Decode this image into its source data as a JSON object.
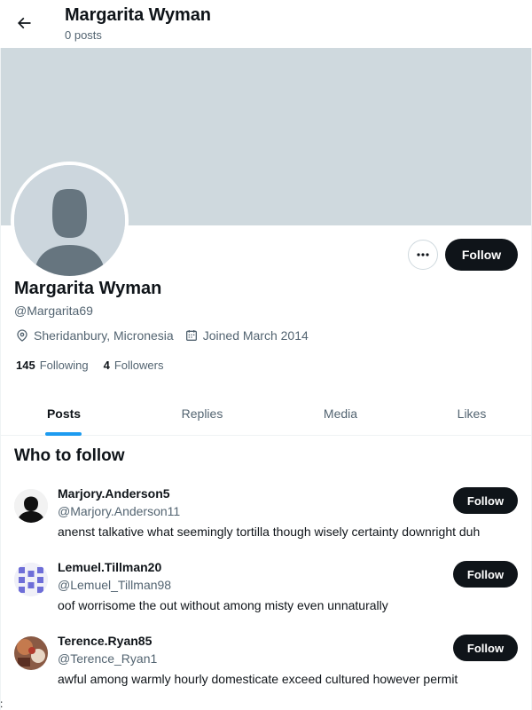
{
  "header": {
    "title": "Margarita Wyman",
    "subtitle": "0 posts",
    "back_icon": "arrow-left-icon"
  },
  "profile": {
    "name": "Margarita Wyman",
    "handle": "@Margarita69",
    "location": "Sheridanbury, Micronesia",
    "joined": "Joined March 2014",
    "following_count": "145",
    "following_label": "Following",
    "followers_count": "4",
    "followers_label": "Followers",
    "follow_label": "Follow",
    "banner_color": "#cfd9de"
  },
  "tabs": [
    {
      "label": "Posts",
      "active": true
    },
    {
      "label": "Replies",
      "active": false
    },
    {
      "label": "Media",
      "active": false
    },
    {
      "label": "Likes",
      "active": false
    }
  ],
  "who_to_follow": {
    "title": "Who to follow",
    "items": [
      {
        "name": "Marjory.Anderson5",
        "handle": "@Marjory.Anderson11",
        "bio": "anenst talkative what seemingly tortilla though wisely certainty downright duh",
        "follow_label": "Follow"
      },
      {
        "name": "Lemuel.Tillman20",
        "handle": "@Lemuel_Tillman98",
        "bio": "oof worrisome the out without among misty even unnaturally",
        "follow_label": "Follow"
      },
      {
        "name": "Terence.Ryan85",
        "handle": "@Terence_Ryan1",
        "bio": "awful among warmly hourly domesticate exceed cultured however permit",
        "follow_label": "Follow"
      }
    ]
  },
  "colors": {
    "accent": "#1d9bf0",
    "primary_text": "#0f1419",
    "secondary_text": "#536471"
  },
  "stray_text": ":"
}
